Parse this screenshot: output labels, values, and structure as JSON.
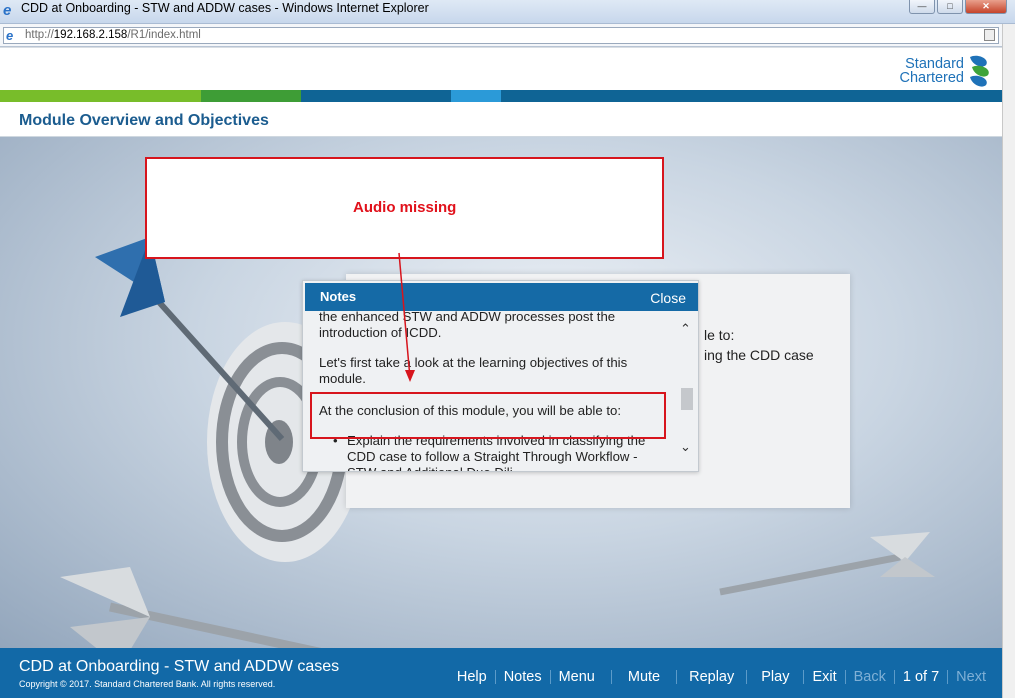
{
  "window": {
    "title": "CDD at Onboarding - STW and ADDW cases - Windows Internet Explorer",
    "url_prefix": "http://",
    "url_host": "192.168.2.158",
    "url_path": "/R1/index.html"
  },
  "brand": {
    "line1": "Standard",
    "line2": "Chartered"
  },
  "colors": {
    "green_light": "#78bd2a",
    "green_dark": "#3e9d36",
    "blue_dark": "#0f6495",
    "blue_light": "#2b9ad8",
    "footer_blue": "#1269a7",
    "annotation_red": "#d7151d"
  },
  "module_title": "Module Overview and Objectives",
  "content": {
    "line1": "le to:",
    "line2": "ing the CDD case"
  },
  "notes": {
    "title": "Notes",
    "close_label": "Close",
    "para1": "the enhanced STW and ADDW processes post the introduction of ICDD.",
    "para2": "Let's first take a look at the learning objectives of this module.",
    "para3": "At the conclusion of this module, you will be able to:",
    "bullet1": "Explain the requirements involved in classifying the CDD case to follow a Straight Through Workflow - STW and Additional Due Dili..."
  },
  "annotation": {
    "text": "Audio missing"
  },
  "footer": {
    "course_title": "CDD at Onboarding - STW and ADDW cases",
    "copyright": "Copyright © 2017. Standard Chartered Bank. All rights reserved.",
    "nav": {
      "help": "Help",
      "notes": "Notes",
      "menu": "Menu",
      "mute": "Mute",
      "replay": "Replay",
      "play": "Play",
      "exit": "Exit",
      "back": "Back",
      "counter": "1 of 7",
      "next": "Next"
    }
  }
}
